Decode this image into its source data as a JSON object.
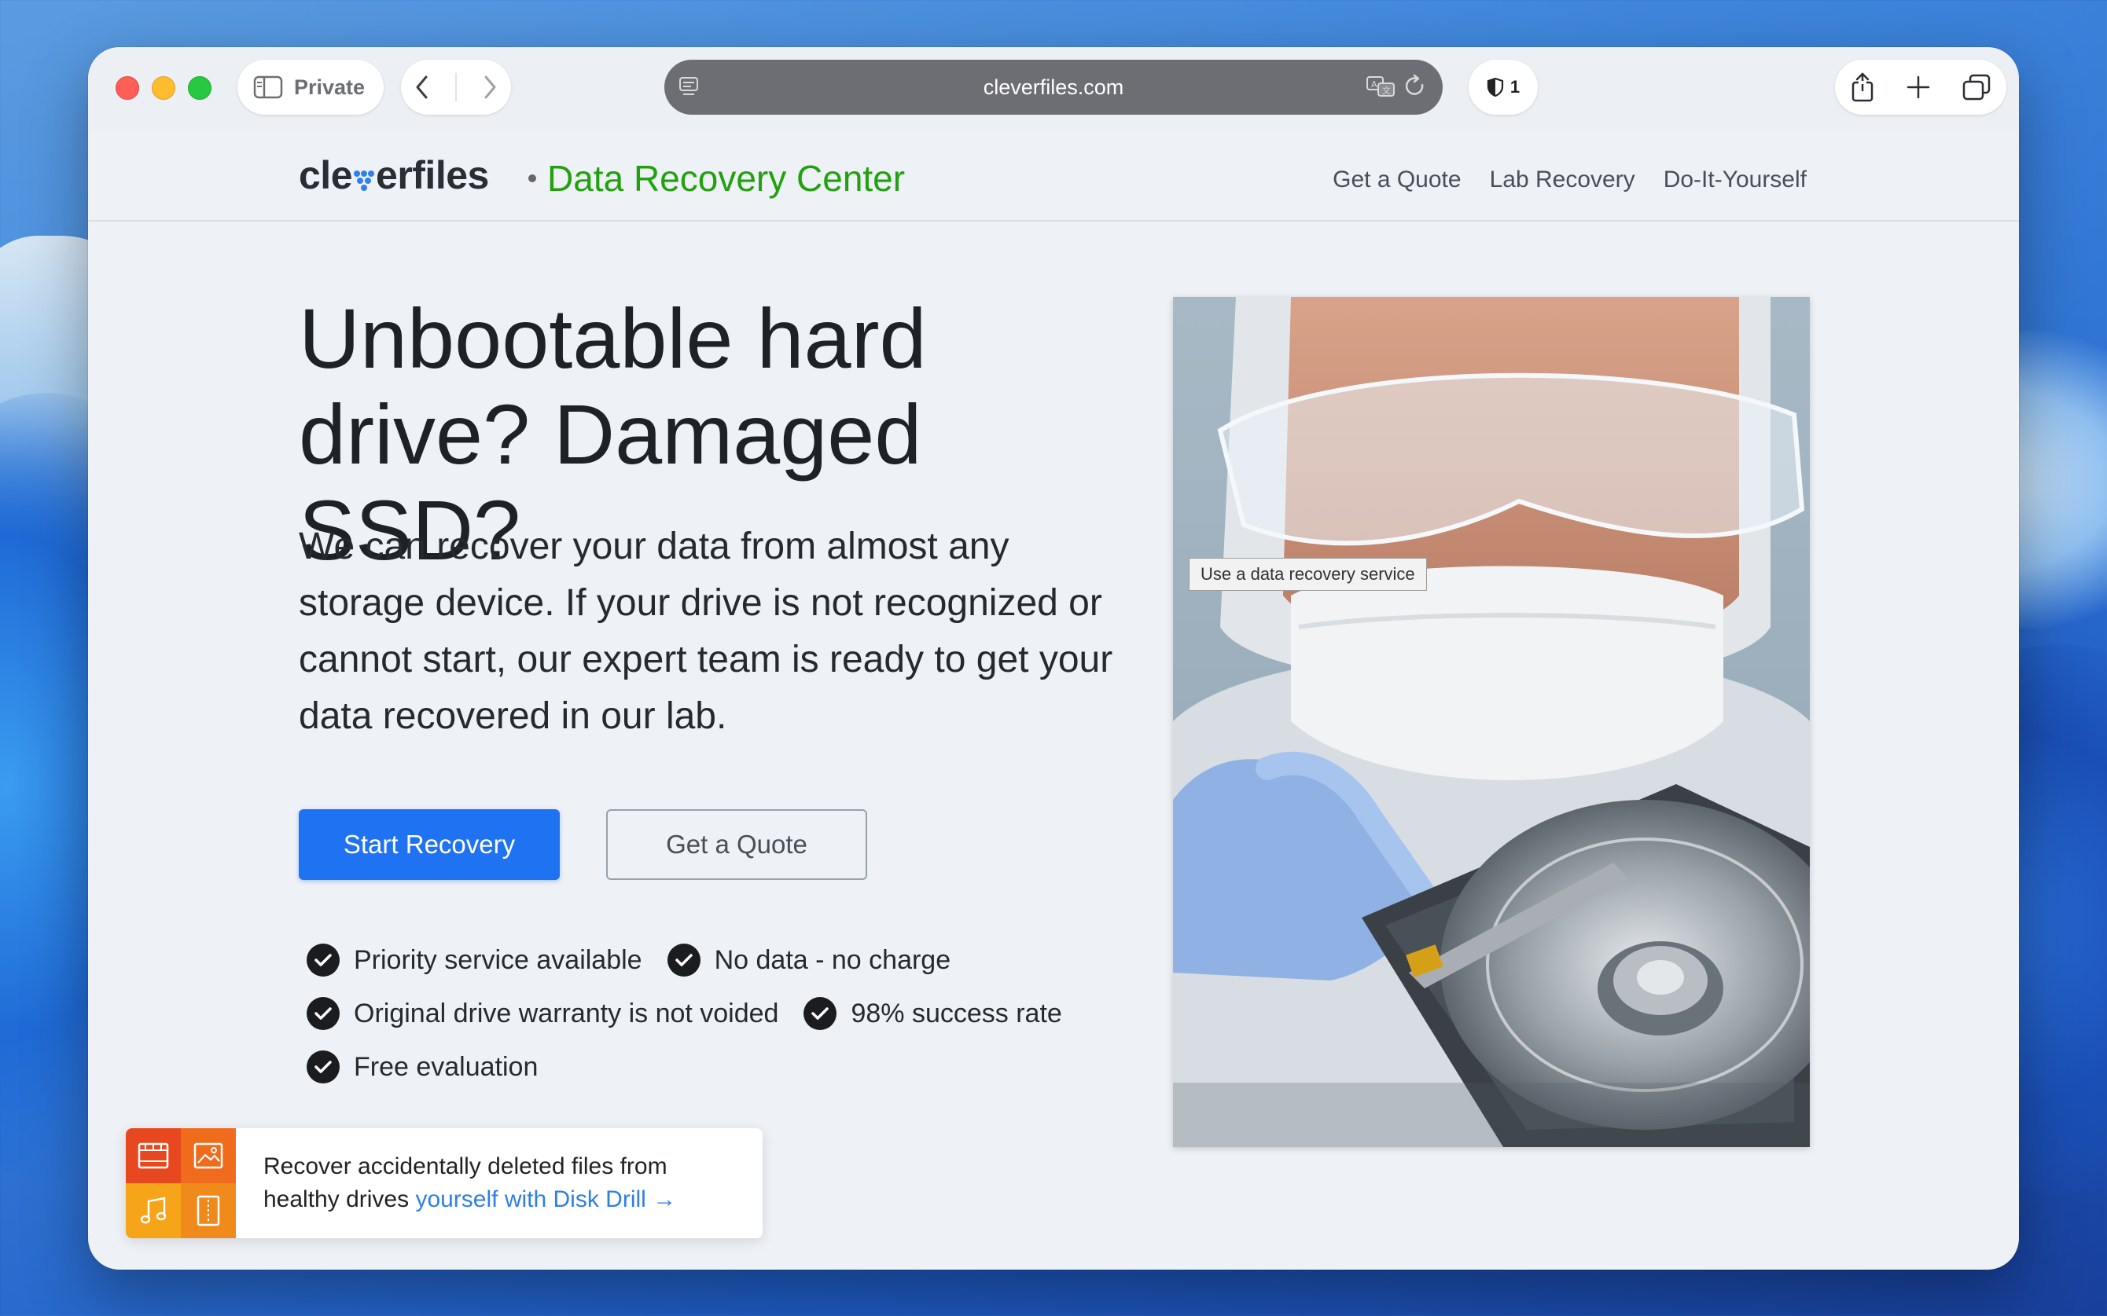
{
  "browser": {
    "private_label": "Private",
    "url": "cleverfiles.com",
    "shield_count": "1"
  },
  "header": {
    "logo_prefix": "cle",
    "logo_suffix": "erfiles",
    "brand_subtitle": "Data Recovery Center",
    "nav": [
      "Get a Quote",
      "Lab Recovery",
      "Do-It-Yourself"
    ]
  },
  "hero": {
    "title_line1": "Unbootable hard",
    "title_line2": "drive? Damaged SSD?",
    "text": "We can recover your data from almost any storage device. If your drive is not recognized or cannot start, our expert team is ready to get your data recovered in our lab.",
    "primary_button": "Start Recovery",
    "secondary_button": "Get a Quote",
    "features": [
      "Priority service available",
      "No data - no charge",
      "Original drive warranty is not voided",
      "98% success rate",
      "Free evaluation"
    ],
    "image_tooltip": "Use a data recovery service"
  },
  "promo": {
    "line1": "Recover accidentally deleted files from",
    "line2_plain": "healthy drives ",
    "line2_link": "yourself with Disk Drill →"
  },
  "colors": {
    "accent_blue": "#1f72f1",
    "brand_green": "#22a10e",
    "link_blue": "#2f7fe6"
  },
  "icons": [
    "sidebar-icon",
    "chevron-left-icon",
    "chevron-right-icon",
    "page-menu-icon",
    "translate-icon",
    "reload-icon",
    "shield-icon",
    "share-icon",
    "plus-icon",
    "tabs-icon",
    "check-icon",
    "film-icon",
    "image-icon",
    "music-icon",
    "archive-icon"
  ]
}
